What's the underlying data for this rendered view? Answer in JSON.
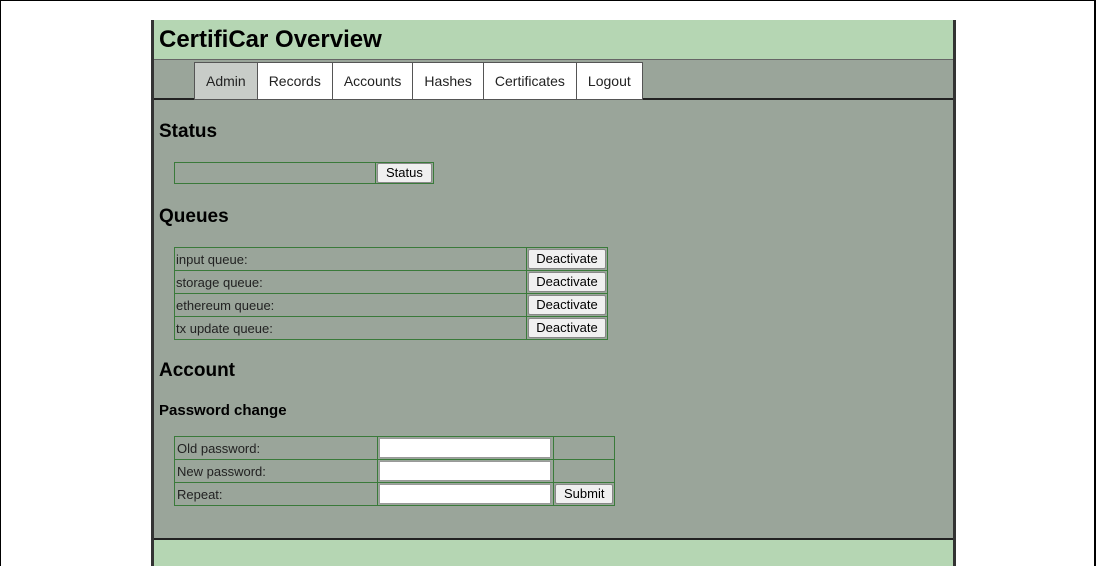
{
  "header": {
    "title": "CertifiCar Overview"
  },
  "nav": {
    "tabs": [
      {
        "label": "Admin",
        "active": true
      },
      {
        "label": "Records"
      },
      {
        "label": "Accounts"
      },
      {
        "label": "Hashes"
      },
      {
        "label": "Certificates"
      },
      {
        "label": "Logout"
      }
    ]
  },
  "status": {
    "heading": "Status",
    "value": "",
    "button_label": "Status"
  },
  "queues": {
    "heading": "Queues",
    "items": [
      {
        "label": "input queue:",
        "button_label": "Deactivate"
      },
      {
        "label": "storage queue:",
        "button_label": "Deactivate"
      },
      {
        "label": "ethereum queue:",
        "button_label": "Deactivate"
      },
      {
        "label": "tx update queue:",
        "button_label": "Deactivate"
      }
    ]
  },
  "account": {
    "heading": "Account",
    "password_change": {
      "heading": "Password change",
      "old_label": "Old password:",
      "new_label": "New password:",
      "repeat_label": "Repeat:",
      "old_value": "",
      "new_value": "",
      "repeat_value": "",
      "submit_label": "Submit"
    }
  },
  "colors": {
    "header_bg": "#b5d6b3",
    "page_bg": "#9aa59a",
    "border_green": "#3a7a3a"
  }
}
